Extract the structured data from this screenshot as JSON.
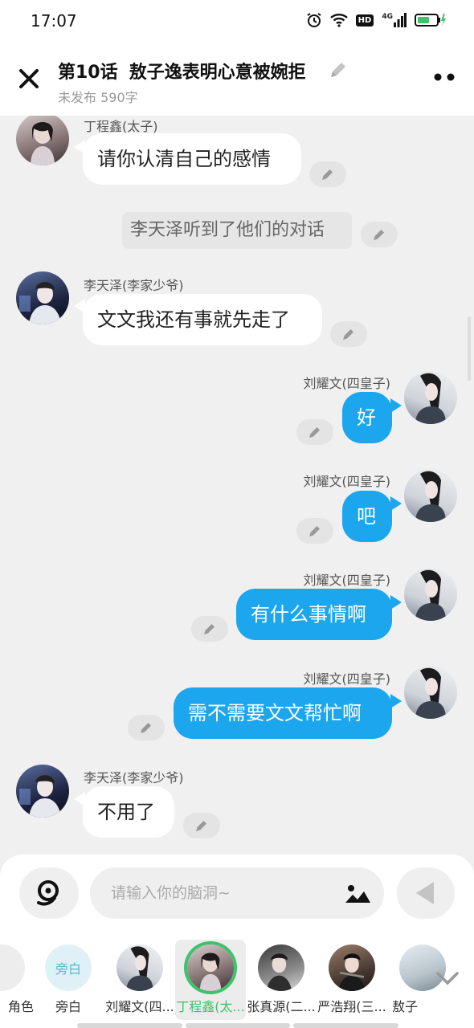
{
  "status_bar": {
    "time": "17:07",
    "network": "4G",
    "hd": "HD"
  },
  "header": {
    "episode": "第10话",
    "title": "敖子逸表明心意被婉拒",
    "subtitle": "未发布 590字"
  },
  "messages": [
    {
      "side": "left",
      "speaker": "丁程鑫(太子)",
      "text": "请你认清自己的感情"
    },
    {
      "side": "narration",
      "text": "李天泽听到了他们的对话"
    },
    {
      "side": "left",
      "speaker": "李天泽(李家少爷)",
      "text": "文文我还有事就先走了"
    },
    {
      "side": "right",
      "speaker": "刘耀文(四皇子)",
      "text": "好"
    },
    {
      "side": "right",
      "speaker": "刘耀文(四皇子)",
      "text": "吧"
    },
    {
      "side": "right",
      "speaker": "刘耀文(四皇子)",
      "text": "有什么事情啊"
    },
    {
      "side": "right",
      "speaker": "刘耀文(四皇子)",
      "text": "需不需要文文帮忙啊"
    },
    {
      "side": "left",
      "speaker": "李天泽(李家少爷)",
      "text": "不用了"
    }
  ],
  "composer": {
    "placeholder": "请输入你的脑洞~"
  },
  "characters": [
    {
      "label": "角色",
      "avatar_text": ""
    },
    {
      "label": "旁白",
      "avatar_text": "旁白"
    },
    {
      "label": "刘耀文(四...",
      "avatar_text": ""
    },
    {
      "label": "丁程鑫(太...",
      "avatar_text": ""
    },
    {
      "label": "张真源(二...",
      "avatar_text": ""
    },
    {
      "label": "严浩翔(三...",
      "avatar_text": ""
    },
    {
      "label": "敖子",
      "avatar_text": ""
    }
  ],
  "colors": {
    "accent_blue": "#1ba6ee",
    "active_green": "#3ec26b",
    "background": "#f0f0f0"
  },
  "icons": [
    "alarm-icon",
    "wifi-icon",
    "signal-icon",
    "battery-icon",
    "close-icon",
    "pencil-icon",
    "more-icon",
    "voice-icon",
    "image-icon",
    "send-icon",
    "chevron-down-icon"
  ]
}
